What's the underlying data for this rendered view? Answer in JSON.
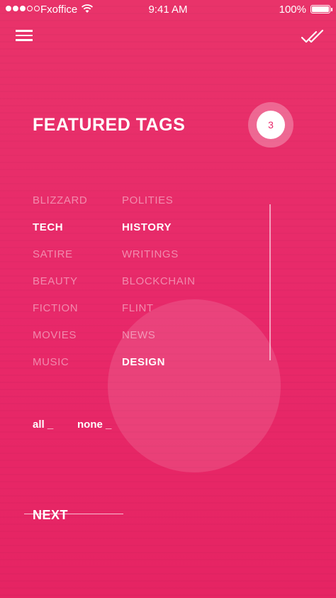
{
  "status_bar": {
    "carrier": "Fxoffice",
    "time": "9:41 AM",
    "battery": "100%"
  },
  "header": {
    "menu_icon": "hamburger-menu-icon",
    "done_icon": "double-check-icon"
  },
  "title": "FEATURED TAGS",
  "selected_count": "3",
  "tags": {
    "left": [
      {
        "label": "BLIZZARD",
        "selected": false
      },
      {
        "label": "TECH",
        "selected": true
      },
      {
        "label": "SATIRE",
        "selected": false
      },
      {
        "label": "BEAUTY",
        "selected": false
      },
      {
        "label": "FICTION",
        "selected": false
      },
      {
        "label": "MOVIES",
        "selected": false
      },
      {
        "label": "MUSIC",
        "selected": false
      }
    ],
    "right": [
      {
        "label": "POLITIES",
        "selected": false
      },
      {
        "label": "HISTORY",
        "selected": true
      },
      {
        "label": "WRITINGS",
        "selected": false
      },
      {
        "label": "BLOCKCHAIN",
        "selected": false
      },
      {
        "label": "FLINT",
        "selected": false
      },
      {
        "label": "NEWS",
        "selected": false
      },
      {
        "label": "DESIGN",
        "selected": true
      }
    ]
  },
  "selection": {
    "all_label": "all _",
    "none_label": "none _"
  },
  "next_label": "NEXT",
  "colors": {
    "background": "#E8296A",
    "text": "#FFFFFF",
    "badge_text": "#E8296A"
  }
}
